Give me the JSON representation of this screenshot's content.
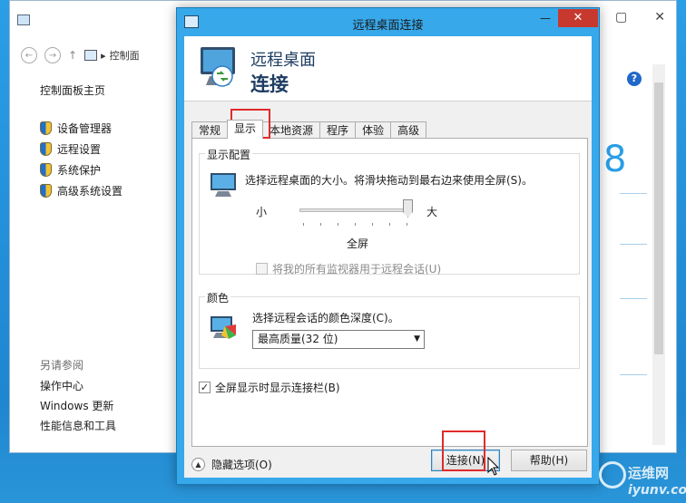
{
  "background_window": {
    "window_controls": [
      "—",
      "▢",
      "✕"
    ],
    "nav": {
      "back": "←",
      "forward": "→",
      "up": "↑"
    },
    "address": "控制面",
    "sidebar_home": "控制面板主页",
    "sidebar_items": [
      "设备管理器",
      "远程设置",
      "系统保护",
      "高级系统设置"
    ],
    "see_also_title": "另请参阅",
    "see_also_links": [
      "操作中心",
      "Windows 更新",
      "性能信息和工具"
    ],
    "help_glyph": "?",
    "big_digit": "8"
  },
  "dialog": {
    "title": "远程桌面连接",
    "minimize": "—",
    "close": "✕",
    "banner_line1": "远程桌面",
    "banner_line2": "连接",
    "tabs": [
      "常规",
      "显示",
      "本地资源",
      "程序",
      "体验",
      "高级"
    ],
    "active_tab": "显示",
    "display_group": {
      "label": "显示配置",
      "description": "选择远程桌面的大小。将滑块拖动到最右边来使用全屏(S)。",
      "small_label": "小",
      "large_label": "大",
      "size_value": "全屏",
      "slider_fraction": 1.0,
      "multimon_label": "将我的所有监视器用于远程会话(U)",
      "multimon_checked": false
    },
    "color_group": {
      "label": "颜色",
      "description": "选择远程会话的颜色深度(C)。",
      "selected": "最高质量(32 位)"
    },
    "show_bar_label": "全屏显示时显示连接栏(B)",
    "show_bar_checked": true,
    "hide_options": "隐藏选项(O)",
    "connect_button": "连接(N)",
    "help_button": "帮助(H)"
  },
  "watermark": {
    "cn": "运维网",
    "en": "iyunv.com"
  },
  "colors": {
    "accent": "#37a8ea",
    "highlight": "#e02a2a",
    "close": "#c7392f"
  }
}
